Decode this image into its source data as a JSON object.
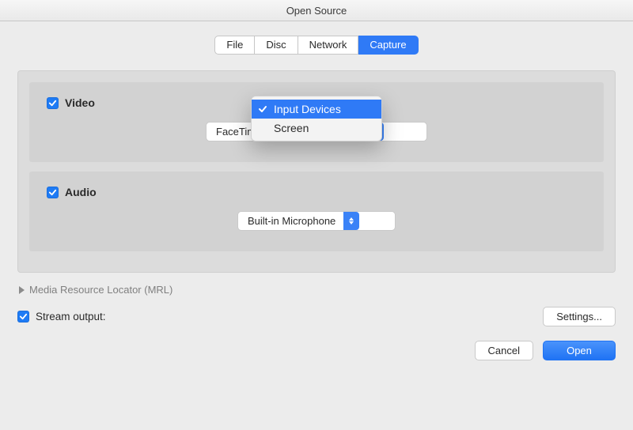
{
  "window": {
    "title": "Open Source"
  },
  "tabs": [
    {
      "label": "File"
    },
    {
      "label": "Disc"
    },
    {
      "label": "Network"
    },
    {
      "label": "Capture",
      "active": true
    }
  ],
  "capture_dropdown": {
    "options": [
      {
        "label": "Input Devices",
        "selected": true
      },
      {
        "label": "Screen"
      }
    ]
  },
  "video": {
    "section_label": "Video",
    "checked": true,
    "selected_device": "FaceTime HD Camera (Built-in)"
  },
  "audio": {
    "section_label": "Audio",
    "checked": true,
    "selected_device": "Built-in Microphone"
  },
  "mrl": {
    "label": "Media Resource Locator (MRL)"
  },
  "stream_output": {
    "label": "Stream output:",
    "checked": true
  },
  "buttons": {
    "settings": "Settings...",
    "cancel": "Cancel",
    "open": "Open"
  }
}
